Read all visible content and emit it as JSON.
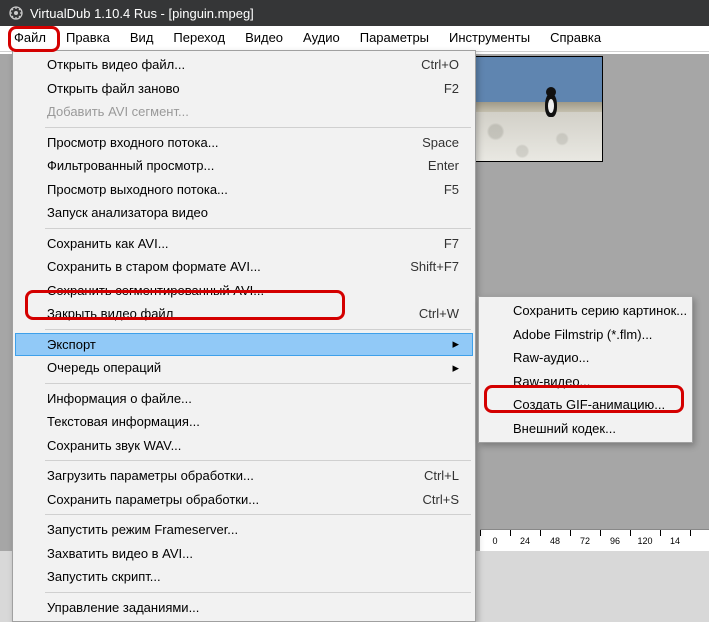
{
  "title": "VirtualDub 1.10.4 Rus - [pinguin.mpeg]",
  "menubar": {
    "file": "Файл",
    "edit": "Правка",
    "view": "Вид",
    "goto": "Переход",
    "video": "Видео",
    "audio": "Аудио",
    "options": "Параметры",
    "tools": "Инструменты",
    "help": "Справка"
  },
  "file_menu": {
    "open_video": {
      "label": "Открыть видео файл...",
      "shortcut": "Ctrl+O"
    },
    "reopen": {
      "label": "Открыть файл заново",
      "shortcut": "F2"
    },
    "add_avi": {
      "label": "Добавить AVI сегмент..."
    },
    "preview_in": {
      "label": "Просмотр входного потока...",
      "shortcut": "Space"
    },
    "preview_filtered": {
      "label": "Фильтрованный просмотр...",
      "shortcut": "Enter"
    },
    "preview_out": {
      "label": "Просмотр выходного потока...",
      "shortcut": "F5"
    },
    "run_analyzer": {
      "label": "Запуск анализатора видео"
    },
    "save_avi": {
      "label": "Сохранить как AVI...",
      "shortcut": "F7"
    },
    "save_old_avi": {
      "label": "Сохранить в старом формате AVI...",
      "shortcut": "Shift+F7"
    },
    "save_segmented": {
      "label": "Сохранить сегментированный AVI..."
    },
    "close_video": {
      "label": "Закрыть видео файл",
      "shortcut": "Ctrl+W"
    },
    "export": {
      "label": "Экспорт"
    },
    "queue": {
      "label": "Очередь операций"
    },
    "file_info": {
      "label": "Информация о файле..."
    },
    "text_info": {
      "label": "Текстовая информация..."
    },
    "save_wav": {
      "label": "Сохранить звук WAV..."
    },
    "load_proc": {
      "label": "Загрузить параметры обработки...",
      "shortcut": "Ctrl+L"
    },
    "save_proc": {
      "label": "Сохранить параметры обработки...",
      "shortcut": "Ctrl+S"
    },
    "frameserver": {
      "label": "Запустить режим Frameserver..."
    },
    "capture_avi": {
      "label": "Захватить видео в AVI..."
    },
    "run_script": {
      "label": "Запустить скрипт..."
    },
    "job_control": {
      "label": "Управление заданиями..."
    }
  },
  "export_submenu": {
    "image_sequence": "Сохранить серию картинок...",
    "filmstrip": "Adobe Filmstrip (*.flm)...",
    "raw_audio": "Raw-аудио...",
    "raw_video": "Raw-видео...",
    "create_gif": "Создать GIF-анимацию...",
    "external_codec": "Внешний кодек..."
  },
  "timeline_ticks": [
    "0",
    "24",
    "48",
    "72",
    "96",
    "120",
    "14"
  ]
}
